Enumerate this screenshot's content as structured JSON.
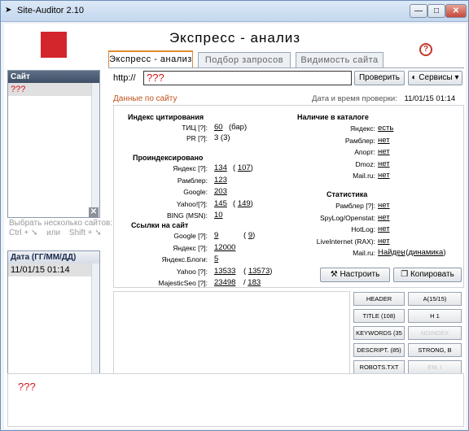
{
  "window": {
    "title": "Site-Auditor 2.10",
    "min": "—",
    "max": "□",
    "close": "✕"
  },
  "header": {
    "title": "Экспресс - анализ",
    "help": "?"
  },
  "tabs": [
    {
      "label": "Экспресс - анализ"
    },
    {
      "label": "Подбор запросов"
    },
    {
      "label": "Видимость сайта"
    }
  ],
  "sites_panel": {
    "header": "Сайт",
    "selected": "???",
    "remove_label": "✕"
  },
  "multi_select_hint": {
    "line1": "Выбрать несколько сайтов:",
    "ctrl": "Ctrl +",
    "or": "или",
    "shift": "Shift +"
  },
  "dates_panel": {
    "header": "Дата (ГГ/ММ/ДД)",
    "row": "11/01/15 01:14"
  },
  "url": {
    "prefix": "http://",
    "value": "???",
    "check_button": "Проверить",
    "services_button": "Сервисы"
  },
  "site_data": {
    "title": "Данные по сайту",
    "check_time_label": "Дата и время проверки:",
    "check_time": "11/01/15 01:14",
    "citation": {
      "header": "Индекс цитирования",
      "tic_label": "ТИЦ [?]:",
      "tic_value": "60",
      "tic_note": "(бар)",
      "pr_label": "PR [?]:",
      "pr_value": "3 (3)"
    },
    "indexed": {
      "header": "Проиндексировано",
      "rows": [
        {
          "label": "Яндекс [?]:",
          "value": "134",
          "extra": "107"
        },
        {
          "label": "Рамблер:",
          "value": "123",
          "extra": ""
        },
        {
          "label": "Google:",
          "value": "203",
          "extra": ""
        },
        {
          "label": "Yahoo![?]:",
          "value": "145",
          "extra": "149"
        },
        {
          "label": "BING (MSN):",
          "value": "10",
          "extra": ""
        }
      ]
    },
    "links": {
      "header": "Ссылки на сайт",
      "rows": [
        {
          "label": "Google [?]:",
          "value": "9",
          "extra": "9"
        },
        {
          "label": "Яндекс [?]:",
          "value": "12000",
          "extra": ""
        },
        {
          "label": "Яндекс.Блоги:",
          "value": "5",
          "extra": ""
        },
        {
          "label": "Yahoo [?]:",
          "value": "13533",
          "extra": "13573"
        },
        {
          "label": "MajesticSeo [?]:",
          "value": "23498",
          "extra": "183"
        }
      ]
    },
    "catalogs": {
      "header": "Наличие в каталоге",
      "rows": [
        {
          "label": "Яндекс:",
          "value": "есть"
        },
        {
          "label": "Рамблер:",
          "value": "нет"
        },
        {
          "label": "Апорт:",
          "value": "нет"
        },
        {
          "label": "Dmoz:",
          "value": "нет"
        },
        {
          "label": "Mail.ru:",
          "value": "нет"
        }
      ]
    },
    "stats": {
      "header": "Статистика",
      "rows": [
        {
          "label": "Рамблер [?]:",
          "value": "нет"
        },
        {
          "label": "SpyLog/Openstat:",
          "value": "нет"
        },
        {
          "label": "HotLog:",
          "value": "нет"
        },
        {
          "label": "LiveInternet (RAX):",
          "value": "нет"
        },
        {
          "label": "Mail.ru:",
          "value": "Найден",
          "extra": "динамика"
        }
      ]
    },
    "configure_button": "Настроить",
    "copy_button": "Копировать"
  },
  "seo_buttons": [
    {
      "label": "HEADER",
      "disabled": false
    },
    {
      "label": "A(15/15)",
      "disabled": false
    },
    {
      "label": "TITLE (108)",
      "disabled": false
    },
    {
      "label": "H 1",
      "disabled": false
    },
    {
      "label": "KEYWORDS (35",
      "disabled": false
    },
    {
      "label": "NOINDEX",
      "disabled": true
    },
    {
      "label": "DESCRIPT. (85)",
      "disabled": false
    },
    {
      "label": "STRONG, B",
      "disabled": false
    },
    {
      "label": "ROBOTS.TXT",
      "disabled": false
    },
    {
      "label": "EM, I",
      "disabled": true
    }
  ],
  "bottom_text": "???"
}
